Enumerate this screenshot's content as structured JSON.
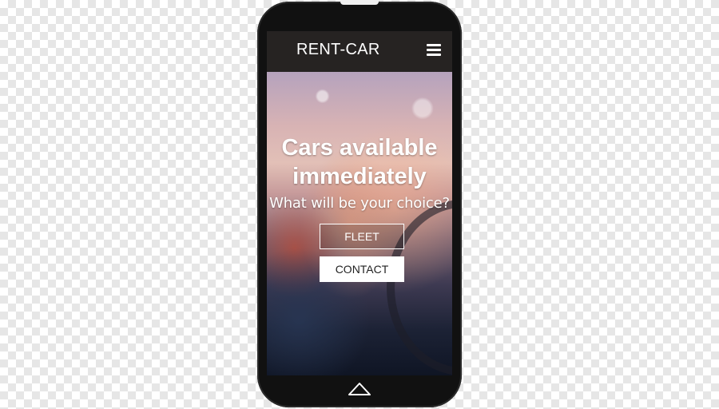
{
  "app": {
    "brand": "RENT-CAR",
    "menu_icon": "hamburger-menu-icon"
  },
  "hero": {
    "headline_line1": "Cars available",
    "headline_line2": "immediately",
    "subtitle": "What will be your choice?",
    "fleet_label": "FLEET",
    "contact_label": "CONTACT"
  },
  "device": {
    "home_icon": "home-icon"
  }
}
